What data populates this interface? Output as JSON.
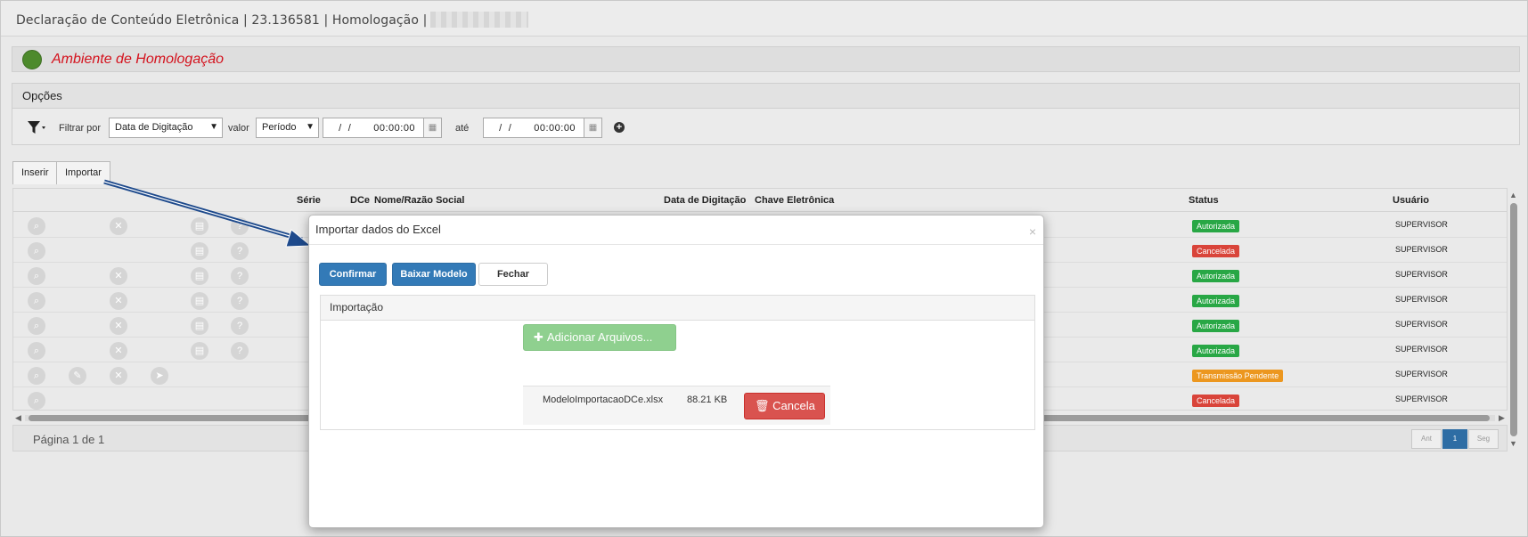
{
  "header": {
    "title": "Declaração de Conteúdo Eletrônica | 23.136581 | Homologação |"
  },
  "env": {
    "label": "Ambiente de Homologação",
    "dot_color": "#4d8a2c",
    "label_color": "#d4121d"
  },
  "options": {
    "title": "Opções",
    "filter_label": "Filtrar por",
    "filter_value": "Data de Digitação",
    "valor_label": "valor",
    "valor_value": "Período",
    "date_from": "  /  /       00:00:00",
    "ate_label": "até",
    "date_to": "  /  /       00:00:00"
  },
  "tabs": {
    "inserir": "Inserir",
    "importar": "Importar"
  },
  "grid": {
    "columns": {
      "serie": "Série",
      "dce": "DCe",
      "nome": "Nome/Razão Social",
      "data": "Data de Digitação",
      "chave": "Chave Eletrônica",
      "status": "Status",
      "usuario": "Usuário"
    },
    "rows": [
      {
        "status": "Autorizada",
        "status_color": "#28a745",
        "user": "SUPERVISOR"
      },
      {
        "status": "Cancelada",
        "status_color": "#d9443a",
        "user": "SUPERVISOR"
      },
      {
        "status": "Autorizada",
        "status_color": "#28a745",
        "user": "SUPERVISOR"
      },
      {
        "status": "Autorizada",
        "status_color": "#28a745",
        "user": "SUPERVISOR"
      },
      {
        "status": "Autorizada",
        "status_color": "#28a745",
        "user": "SUPERVISOR"
      },
      {
        "status": "Autorizada",
        "status_color": "#28a745",
        "user": "SUPERVISOR"
      },
      {
        "status": "Transmissão Pendente",
        "status_color": "#ec971f",
        "user": "SUPERVISOR"
      },
      {
        "status": "Cancelada",
        "status_color": "#d9443a",
        "user": "SUPERVISOR"
      }
    ]
  },
  "pager": {
    "info": "Página 1 de 1",
    "prev": "Ant",
    "current": "1",
    "next": "Seg"
  },
  "modal": {
    "title": "Importar dados do Excel",
    "close": "×",
    "confirm": "Confirmar",
    "download": "Baixar Modelo",
    "close_btn": "Fechar",
    "panel_title": "Importação",
    "add_files": "Adicionar Arquivos...",
    "file_name": "ModeloImportacaoDCe.xlsx",
    "file_size": "88.21 KB",
    "cancel": "Cancela"
  }
}
